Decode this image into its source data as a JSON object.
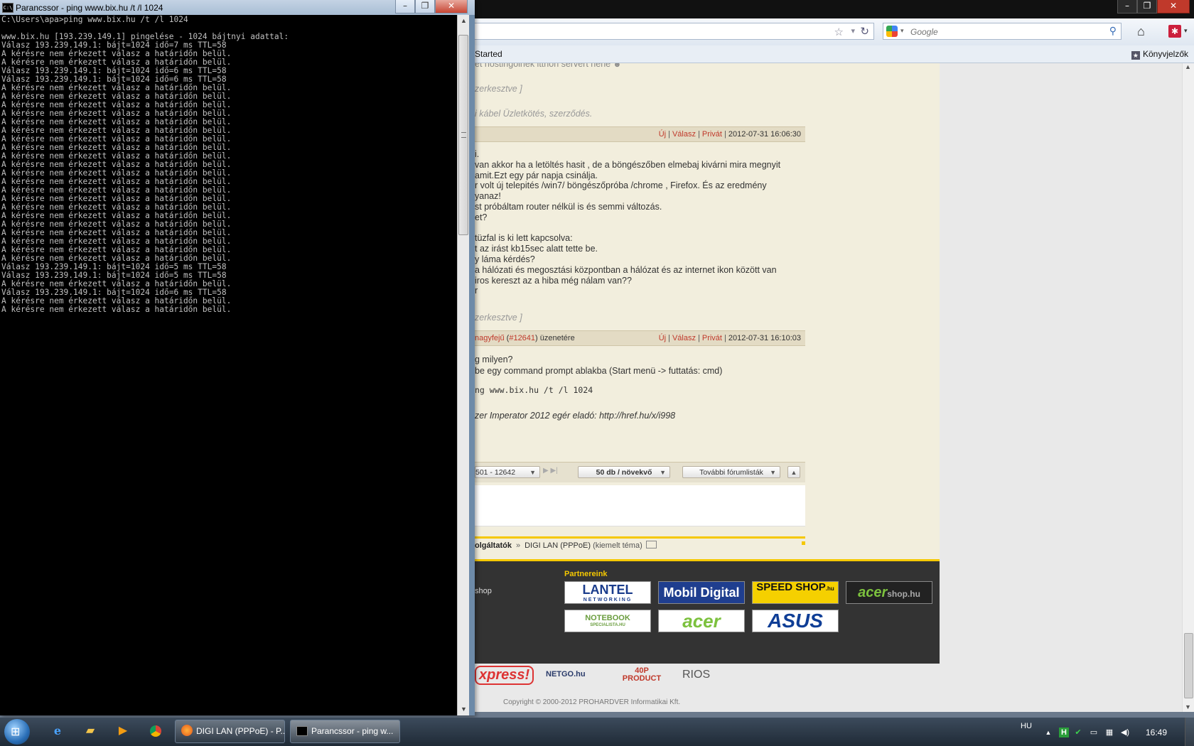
{
  "browser": {
    "search_placeholder": "Google",
    "bookmarks": {
      "getting_started": "Started",
      "bookmarks_menu": "Könyvjelzők"
    }
  },
  "forum": {
    "fragments": [
      {
        "text": "et hostingolnék itthon servert hehe",
        "style": "normal"
      },
      {
        "text": "zerkesztve ]",
        "style": "edit"
      },
      {
        "text": "i kábel Üzletkötés, szerződés.",
        "style": "edit"
      }
    ],
    "post1": {
      "new": "Új",
      "reply": "Válasz",
      "private": "Privát",
      "time": "2012-07-31 16:06:30",
      "lines": [
        "i.",
        "van akkor ha a letöltés hasit , de a böngészőben elmebaj kivárni mira megnyit",
        "amit.Ezt egy pár napja csinálja.",
        "r volt új telepités /win7/ böngészőpróba /chrome , Firefox. És az eredmény",
        "yanaz!",
        "st próbáltam router nélkül is és semmi változás.",
        "et?",
        "",
        "tüzfal is ki lett kapcsolva:",
        "t az irást kb15sec alatt tette be.",
        "y láma kérdés?",
        "a hálózati és megosztási központban a hálózat és az internet ikon között van",
        "iros kereszt az a hiba még nálam van??",
        "r"
      ],
      "edit_note": "zerkesztve ]"
    },
    "post2": {
      "reply_to_user": "nagyfejű",
      "reply_to_id": "#12641",
      "reply_to_suffix": "üzenetére",
      "new": "Új",
      "reply": "Válasz",
      "private": "Privát",
      "time": "2012-07-31 16:10:03",
      "lines": [
        "g milyen?",
        "be egy command prompt ablakba (Start menü -> futtatás: cmd)"
      ],
      "code": "ng www.bix.hu /t /l 1024",
      "signature": "zer Imperator 2012 egér eladó: http://href.hu/x/i998"
    },
    "pager": {
      "range": "501 - 12642",
      "per_page": "50 db / növekvő",
      "more_topics": "További fórumlisták"
    },
    "breadcrumb": {
      "parent": "olgáltatók",
      "arrow": "»",
      "current": "DIGI LAN (PPPoE)",
      "extra": "(kiemelt téma)"
    },
    "footer": {
      "shop_link": "shop",
      "partners_title": "Partnereink",
      "partners": [
        {
          "name": "LANTEL",
          "sub": "NETWORKING"
        },
        {
          "name": "Mobil Digital"
        },
        {
          "name": "SPEED SHOP",
          "sub": ".hu"
        },
        {
          "name": "acer",
          "sub": "shop.hu"
        },
        {
          "name": "NOTEBOOK",
          "sub": "SPECIALISTA.HU"
        },
        {
          "name": "acer"
        },
        {
          "name": "ASUS"
        }
      ],
      "bottom_logos": [
        "xpress!",
        "NETGO.hu",
        "40P PRODUCT",
        "RIOS"
      ],
      "copyright": "Copyright © 2000-2012 PROHARDVER Informatikai Kft."
    }
  },
  "console": {
    "title": "Parancssor - ping  www.bix.hu /t /l 1024",
    "lines": [
      "C:\\Users\\apa>ping www.bix.hu /t /l 1024",
      "",
      "www.bix.hu [193.239.149.1] pingelése - 1024 bájtnyi adattal:",
      "Válasz 193.239.149.1: bájt=1024 idő=7 ms TTL=58",
      "A kérésre nem érkezett válasz a határidőn belül.",
      "A kérésre nem érkezett válasz a határidőn belül.",
      "Válasz 193.239.149.1: bájt=1024 idő=6 ms TTL=58",
      "Válasz 193.239.149.1: bájt=1024 idő=6 ms TTL=58",
      "A kérésre nem érkezett válasz a határidőn belül.",
      "A kérésre nem érkezett válasz a határidőn belül.",
      "A kérésre nem érkezett válasz a határidőn belül.",
      "A kérésre nem érkezett válasz a határidőn belül.",
      "A kérésre nem érkezett válasz a határidőn belül.",
      "A kérésre nem érkezett válasz a határidőn belül.",
      "A kérésre nem érkezett válasz a határidőn belül.",
      "A kérésre nem érkezett válasz a határidőn belül.",
      "A kérésre nem érkezett válasz a határidőn belül.",
      "A kérésre nem érkezett válasz a határidőn belül.",
      "A kérésre nem érkezett válasz a határidőn belül.",
      "A kérésre nem érkezett válasz a határidőn belül.",
      "A kérésre nem érkezett válasz a határidőn belül.",
      "A kérésre nem érkezett válasz a határidőn belül.",
      "A kérésre nem érkezett válasz a határidőn belül.",
      "A kérésre nem érkezett válasz a határidőn belül.",
      "A kérésre nem érkezett válasz a határidőn belül.",
      "A kérésre nem érkezett válasz a határidőn belül.",
      "A kérésre nem érkezett válasz a határidőn belül.",
      "A kérésre nem érkezett válasz a határidőn belül.",
      "A kérésre nem érkezett válasz a határidőn belül.",
      "Válasz 193.239.149.1: bájt=1024 idő=5 ms TTL=58",
      "Válasz 193.239.149.1: bájt=1024 idő=5 ms TTL=58",
      "A kérésre nem érkezett válasz a határidőn belül.",
      "Válasz 193.239.149.1: bájt=1024 idő=6 ms TTL=58",
      "A kérésre nem érkezett válasz a határidőn belül.",
      "A kérésre nem érkezett válasz a határidőn belül."
    ]
  },
  "taskbar": {
    "tasks": [
      {
        "label": "DIGI LAN (PPPoE) - P..."
      },
      {
        "label": "Parancssor - ping w..."
      }
    ],
    "language": "HU",
    "clock": "16:49"
  }
}
